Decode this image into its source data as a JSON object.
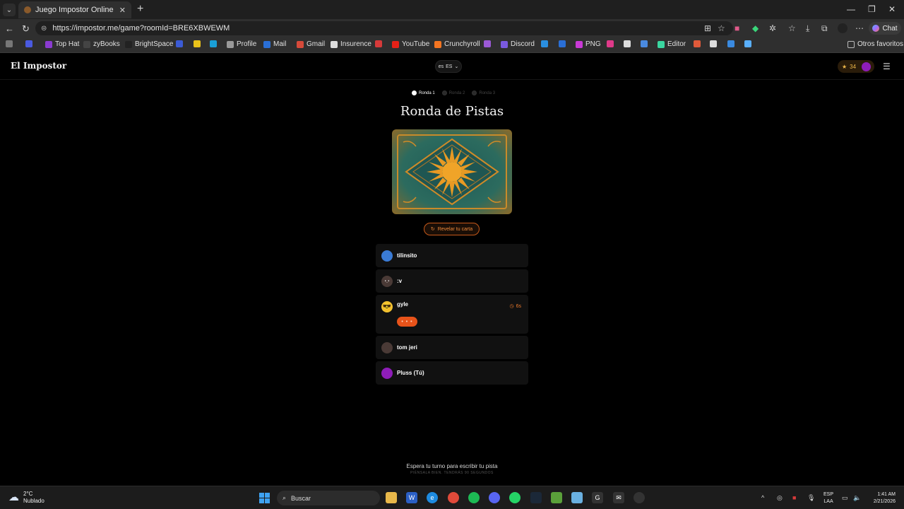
{
  "browser": {
    "tab_title": "Juego Impostor Online Gratis - Jue",
    "url": "https://impostor.me/game?roomId=BRE6XBWEWM",
    "chat_label": "Chat",
    "bookmarks": [
      {
        "label": "Top Hat",
        "color": "#8a3bd0"
      },
      {
        "label": "zyBooks",
        "color": "#444"
      },
      {
        "label": "BrightSpace",
        "color": "#222"
      },
      {
        "label": "",
        "color": "#3b5bd6"
      },
      {
        "label": "",
        "color": "#e9c21a"
      },
      {
        "label": "",
        "color": "#1a9fd6"
      },
      {
        "label": "Profile",
        "color": "#999"
      },
      {
        "label": "Mail",
        "color": "#2a6fd6"
      },
      {
        "label": "Gmail",
        "color": "#d64a3a"
      },
      {
        "label": "Insurence",
        "color": "#ddd"
      },
      {
        "label": "",
        "color": "#d63a3a"
      },
      {
        "label": "YouTube",
        "color": "#e62117"
      },
      {
        "label": "Crunchyroll",
        "color": "#f47521"
      },
      {
        "label": "",
        "color": "#9b59d6"
      },
      {
        "label": "Discord",
        "color": "#7a5ae0"
      },
      {
        "label": "",
        "color": "#2a8fe0"
      },
      {
        "label": "",
        "color": "#2a6fd6"
      },
      {
        "label": "PNG",
        "color": "#c93ad6"
      },
      {
        "label": "",
        "color": "#e03a8a"
      },
      {
        "label": "",
        "color": "#ddd"
      },
      {
        "label": "",
        "color": "#4a8ae0"
      },
      {
        "label": "Editor",
        "color": "#3ad6a0"
      },
      {
        "label": "",
        "color": "#e05a3a"
      },
      {
        "label": "",
        "color": "#ddd"
      },
      {
        "label": "",
        "color": "#3a8ae0"
      },
      {
        "label": "",
        "color": "#5ab0ff"
      }
    ],
    "other_favorites": "Otros favoritos"
  },
  "app": {
    "brand": "El Impostor",
    "lang_flag": "es",
    "lang_code": "ES",
    "stars_count": "34",
    "rounds": [
      {
        "label": "Ronda 1",
        "active": true
      },
      {
        "label": "Ronda 2",
        "active": false
      },
      {
        "label": "Ronda 3",
        "active": false
      }
    ],
    "heading": "Ronda de Pistas",
    "reveal_label": "Revelar tu carta",
    "players": [
      {
        "name": "tilinsito",
        "avatar_color": "#3a7bd5",
        "avatar_glyph": ""
      },
      {
        "name": ":v",
        "avatar_color": "#4a3a36",
        "avatar_glyph": "•_•"
      },
      {
        "name": "gyle",
        "avatar_color": "#f2c230",
        "avatar_glyph": "😎",
        "timer": "6s",
        "typing": "• • •"
      },
      {
        "name": "tom jeri",
        "avatar_color": "#4a3a36",
        "avatar_glyph": ""
      },
      {
        "name": "Pluss (Tú)",
        "avatar_color": "#8e1db8",
        "avatar_glyph": ""
      }
    ],
    "wait_message": "Espera tu turno para escribir tu pista",
    "wait_sub": "PIÉNSALA BIEN. TENDRÁS 90 SEGUNDOS"
  },
  "taskbar": {
    "temp": "2°C",
    "weather": "Nublado",
    "weather_badge": "4",
    "search_placeholder": "Buscar",
    "lang_top": "ESP",
    "lang_bottom": "LAA",
    "time": "1:41 AM",
    "date": "2/21/2026"
  }
}
